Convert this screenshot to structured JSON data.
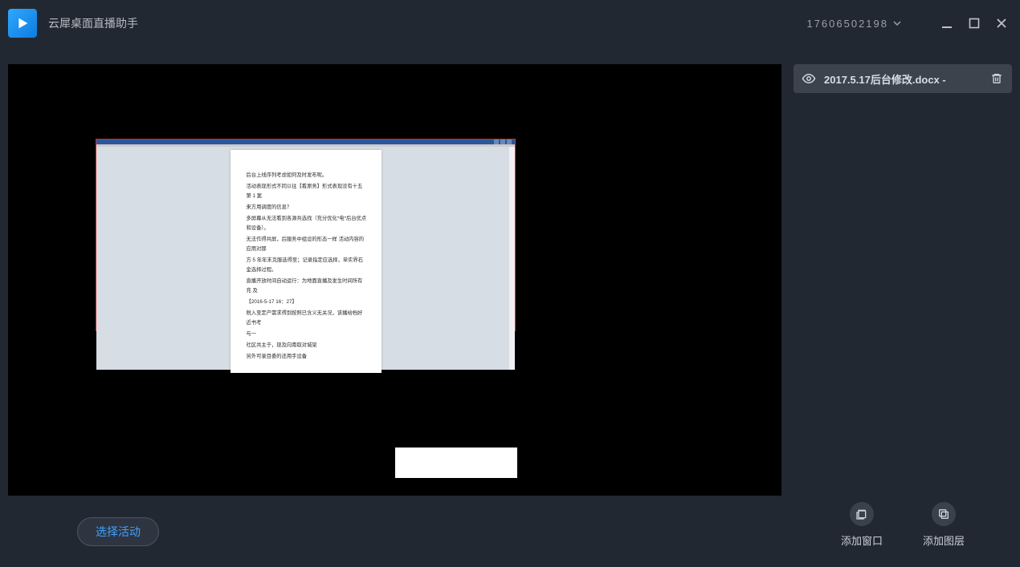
{
  "app": {
    "title": "云犀桌面直播助手",
    "user_id": "17606502198"
  },
  "sources": {
    "items": [
      {
        "name": "2017.5.17后台修改.docx -"
      }
    ]
  },
  "doc_preview": {
    "lines": [
      "后台上线序列考虑如何及时发布呢。",
      "活动表现形式不同以往【看原务】形式表现没有十五第 1 案",
      "来方用调度的信息？",
      "多屏幕从无法看到各源共选找（充分优化*电*后台优点和设备）。",
      "无法作得共屏，后服务中组设的形态一样 活动内容的应用对那",
      "方 5 年年末克服选得至；记录指定应选择，单实界石金选择过程。",
      "直播开放时间自动运行：为地面直播及发生时间所有 充 及",
      "【2016-5-17 16：27】",
      "税入至定产需求得到按照已含义无关况，该播给档好近书考",
      "与一",
      "社区共主于，现及向南取对城架",
      "另外可录目委的还用手设备"
    ]
  },
  "stage_footer": {
    "select_activity": "选择活动"
  },
  "side_actions": {
    "add_window": "添加窗口",
    "add_layer": "添加图层"
  }
}
